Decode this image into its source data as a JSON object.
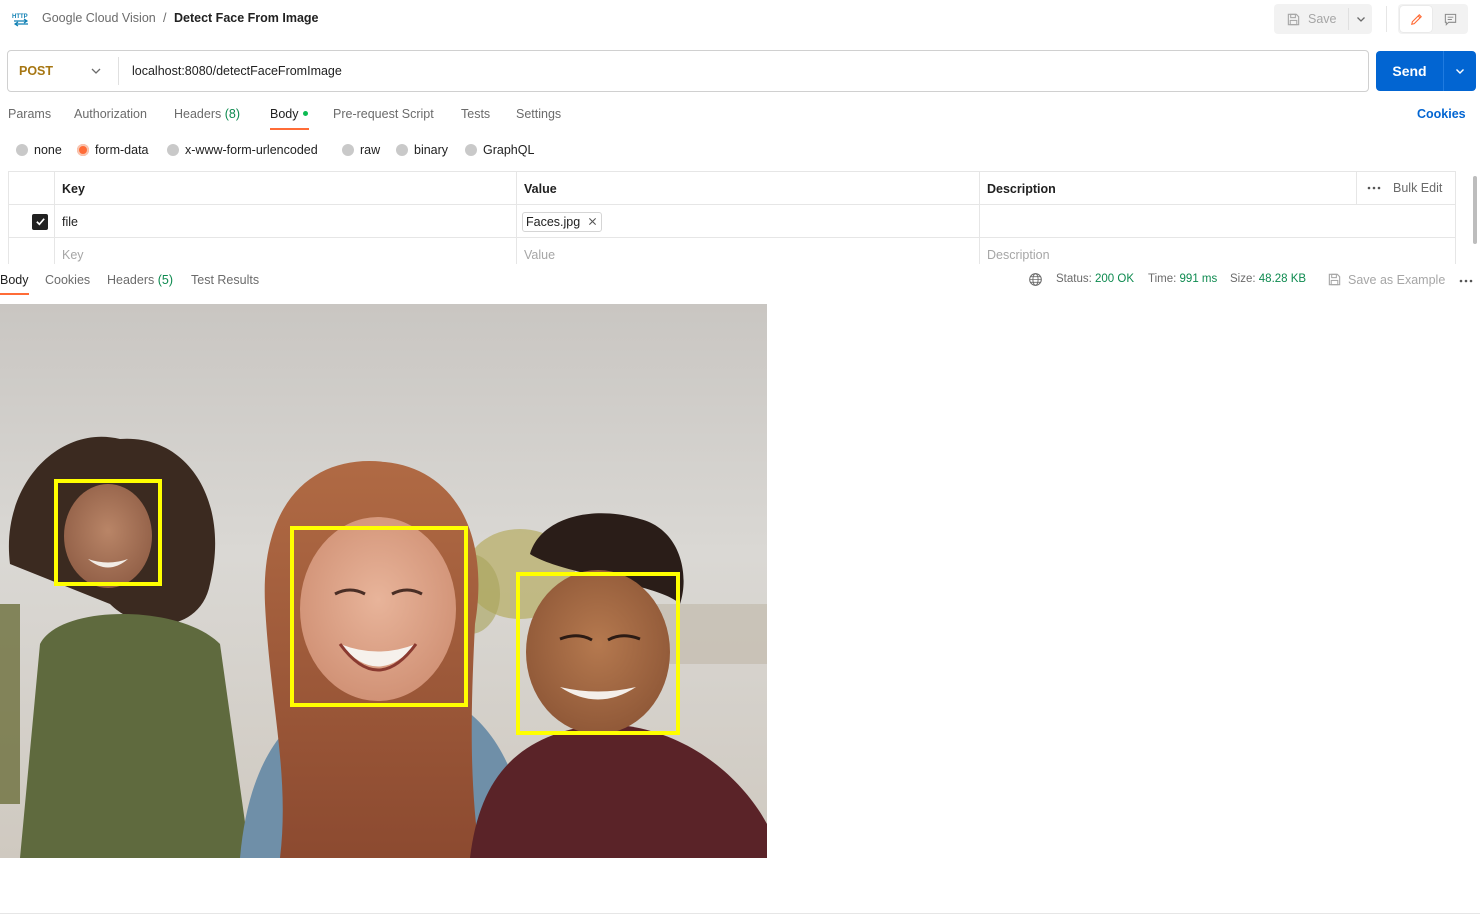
{
  "breadcrumb": {
    "parent": "Google Cloud Vision",
    "separator": "/",
    "current": "Detect Face From Image"
  },
  "toolbar": {
    "save_label": "Save"
  },
  "request": {
    "method": "POST",
    "method_color": "#a67612",
    "url": "localhost:8080/detectFaceFromImage",
    "send_label": "Send",
    "send_color": "#0265d2"
  },
  "request_tabs": {
    "params": "Params",
    "authorization": "Authorization",
    "headers": "Headers",
    "headers_count": "(8)",
    "body": "Body",
    "prerequest": "Pre-request Script",
    "tests": "Tests",
    "settings": "Settings",
    "cookies": "Cookies",
    "active": "Body"
  },
  "body_types": {
    "none": "none",
    "form_data": "form-data",
    "urlencoded": "x-www-form-urlencoded",
    "raw": "raw",
    "binary": "binary",
    "graphql": "GraphQL",
    "selected": "form-data"
  },
  "form_table": {
    "headers": {
      "key": "Key",
      "value": "Value",
      "description": "Description",
      "bulk_edit": "Bulk Edit"
    },
    "rows": [
      {
        "checked": true,
        "key": "file",
        "value": "Faces.jpg",
        "description": ""
      }
    ],
    "placeholders": {
      "key": "Key",
      "value": "Value",
      "description": "Description"
    }
  },
  "response": {
    "tabs": {
      "body": "Body",
      "cookies": "Cookies",
      "headers": "Headers",
      "headers_count": "(5)",
      "test_results": "Test Results",
      "active": "Body"
    },
    "status_label": "Status:",
    "status_value": "200 OK",
    "time_label": "Time:",
    "time_value": "991 ms",
    "size_label": "Size:",
    "size_value": "48.28 KB",
    "save_example": "Save as Example",
    "face_box_color": "#ffff00",
    "detected_faces": 3
  },
  "colors": {
    "accent": "#ff6c37",
    "success": "#0d8a4f",
    "link": "#0265d2"
  }
}
